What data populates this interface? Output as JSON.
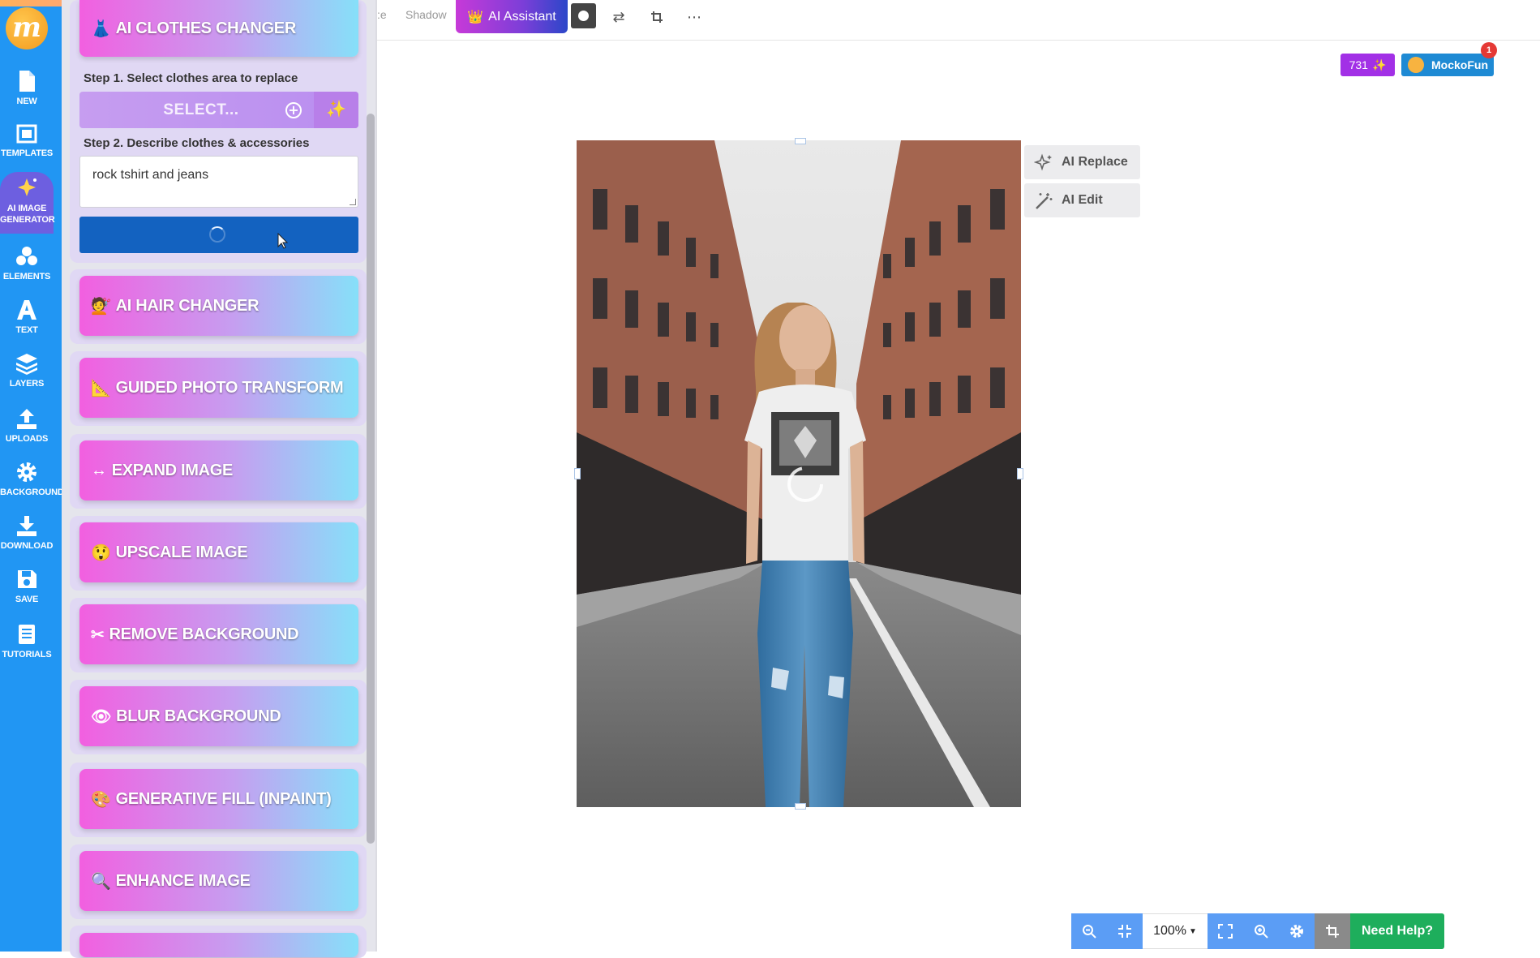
{
  "sidebar": {
    "items": [
      {
        "id": "new",
        "label": "NEW"
      },
      {
        "id": "templates",
        "label": "TEMPLATES"
      },
      {
        "id": "ai-image-generator",
        "label": "AI IMAGE GENERATOR"
      },
      {
        "id": "elements",
        "label": "ELEMENTS"
      },
      {
        "id": "text",
        "label": "TEXT"
      },
      {
        "id": "layers",
        "label": "LAYERS"
      },
      {
        "id": "uploads",
        "label": "UPLOADS"
      },
      {
        "id": "background",
        "label": "BACKGROUND"
      },
      {
        "id": "download",
        "label": "DOWNLOAD"
      },
      {
        "id": "save",
        "label": "SAVE"
      },
      {
        "id": "tutorials",
        "label": "TUTORIALS"
      }
    ]
  },
  "panel": {
    "clothes_changer": {
      "title": "AI CLOTHES CHANGER",
      "step1_label": "Step 1. Select clothes area to replace",
      "select_label": "SELECT...",
      "step2_label": "Step 2. Describe clothes & accessories",
      "description_value": "rock tshirt and jeans"
    },
    "tools": [
      {
        "icon": "💇",
        "label": "AI HAIR CHANGER"
      },
      {
        "icon": "📐",
        "label": "GUIDED PHOTO TRANSFORM"
      },
      {
        "icon": "↔",
        "label": "EXPAND IMAGE"
      },
      {
        "icon": "😲",
        "label": "UPSCALE IMAGE"
      },
      {
        "icon": "✂",
        "label": "REMOVE BACKGROUND"
      },
      {
        "icon": "👁",
        "label": "BLUR BACKGROUND"
      },
      {
        "icon": "🎨",
        "label": "GENERATIVE FILL (INPAINT)"
      },
      {
        "icon": "🔍",
        "label": "ENHANCE IMAGE"
      }
    ]
  },
  "toolbar": {
    "shadow_label": "Shadow",
    "ai_assistant_label": "AI Assistant"
  },
  "account": {
    "credits": "731",
    "username": "MockoFun",
    "notifications": "1"
  },
  "canvas": {
    "ai_replace_label": "AI Replace",
    "ai_edit_label": "AI Edit"
  },
  "zoom": {
    "value": "100%",
    "help_label": "Need Help?"
  },
  "colors": {
    "rail": "#2196f3",
    "generate_button": "#1362c0",
    "help_button": "#1eae5c",
    "credits_badge": "#a230e6"
  }
}
